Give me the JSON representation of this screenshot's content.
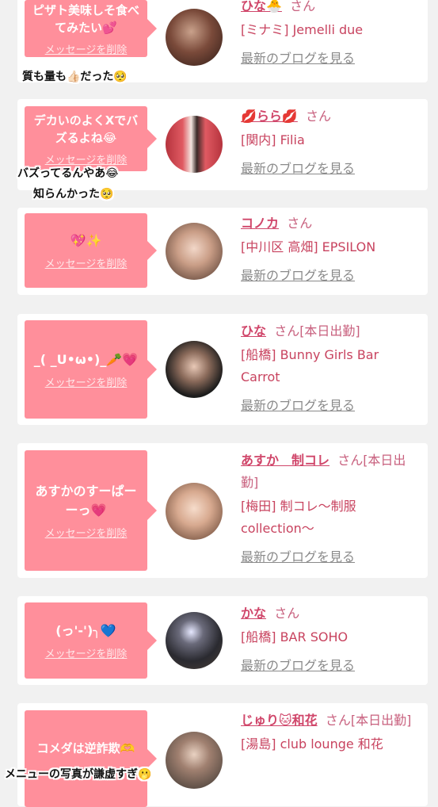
{
  "cards": [
    {
      "message": "ピザト美味しそ食べてみたい💕",
      "delete_label": "メッセージを削除",
      "name": "ひな🐣",
      "suffix": "さん",
      "shop": "[ミナミ] Jemelli due",
      "blog_link": "最新のブログを見る"
    },
    {
      "message": "デカいのよくXでバズるよね😂",
      "delete_label": "メッセージを削除",
      "name": "💋らら💋",
      "suffix": "さん",
      "shop": "[関内] Filia",
      "blog_link": "最新のブログを見る"
    },
    {
      "message": "💖✨",
      "delete_label": "メッセージを削除",
      "name": "コノカ",
      "suffix": "さん",
      "shop": "[中川区 高畑] EPSILON",
      "blog_link": "最新のブログを見る"
    },
    {
      "message": "_( _U•ω•)_🥕💗",
      "delete_label": "メッセージを削除",
      "name": "ひな",
      "suffix": "さん[本日出勤]",
      "shop": "[船橋] Bunny Girls Bar Carrot",
      "blog_link": "最新のブログを見る"
    },
    {
      "message": "あすかのすーぱーーっ💗",
      "delete_label": "メッセージを削除",
      "name": "あすか　制コレ",
      "suffix": "さん[本日出勤]",
      "shop": "[梅田] 制コレ〜制服collection〜",
      "blog_link": "最新のブログを見る"
    },
    {
      "message": "(っ'-')╮💙",
      "delete_label": "メッセージを削除",
      "name": "かな",
      "suffix": "さん",
      "shop": "[船橋] BAR SOHO",
      "blog_link": "最新のブログを見る"
    },
    {
      "message": "コメダは逆詐欺🫶",
      "delete_label": "メッセージを削除",
      "name": "じゅり🐱和花",
      "suffix": "さん[本日出勤]",
      "shop": "[湯島] club lounge 和花",
      "blog_link": ""
    }
  ],
  "captions": {
    "c1": "質も量も👍🏻だった🥺",
    "c2a": "バズってるんやあ😂",
    "c2b": "知らんかった🥺",
    "c3": "メニューの写真が謙虚すぎ🫢"
  },
  "colors": {
    "bubble": "#ff8f9b",
    "name": "#d0466a",
    "background": "#f1f1f1"
  }
}
